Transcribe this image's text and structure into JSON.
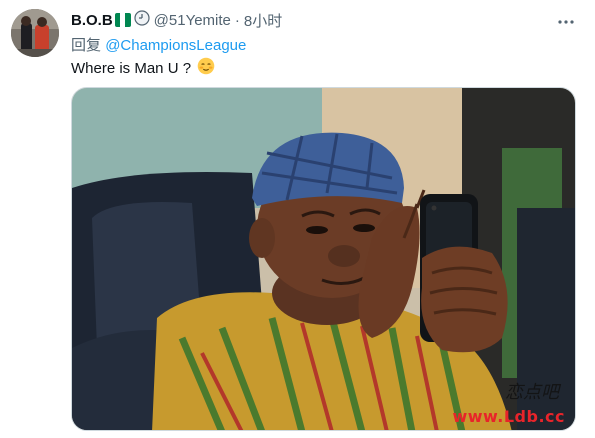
{
  "tweet": {
    "author_name": "B.O.B",
    "handle": "@51Yemite",
    "separator": "·",
    "time": "8小时",
    "reply_prefix": "回复",
    "reply_mention": "@ChampionsLeague",
    "text": "Where is Man U ?",
    "emoji": "relieved-face-emoji"
  },
  "watermark": {
    "cn": "恋点吧",
    "url": "www.Ldb.cc"
  },
  "colors": {
    "link": "#1d9bf0",
    "secondary": "#536471",
    "flag_green": "#008751",
    "watermark": "#e8242a"
  },
  "icons": [
    "more-icon",
    "clock-icon",
    "nigeria-flag-icon"
  ]
}
